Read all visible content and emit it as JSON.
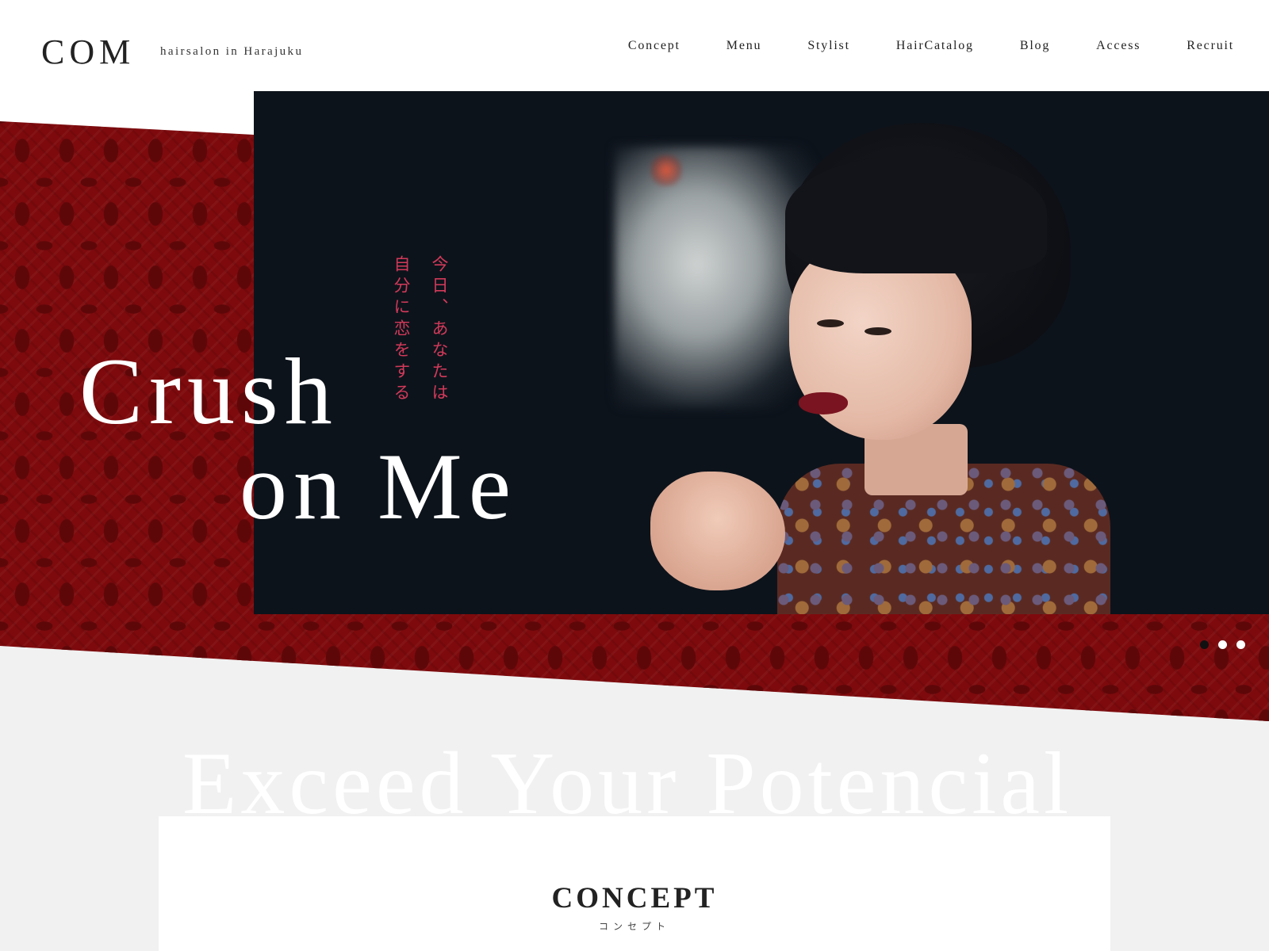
{
  "header": {
    "logo": "COM",
    "tagline": "hairsalon in Harajuku",
    "nav": [
      "Concept",
      "Menu",
      "Stylist",
      "HairCatalog",
      "Blog",
      "Access",
      "Recruit"
    ]
  },
  "hero": {
    "title_line1": "Crush",
    "title_line2": "on Me",
    "jp_line1": "今日、あなたは",
    "jp_line2": "自分に恋をする",
    "slider": {
      "count": 3,
      "active": 1
    },
    "photo": "portrait-photo"
  },
  "concept": {
    "bg_heading": "Exceed Your Potencial",
    "title": "CONCEPT",
    "subtitle": "コンセプト"
  },
  "colors": {
    "accent_red": "#7e0a0d",
    "jp_text": "#d23a5a",
    "photo_bg": "#0d131b",
    "section_bg": "#f1f1f1"
  }
}
